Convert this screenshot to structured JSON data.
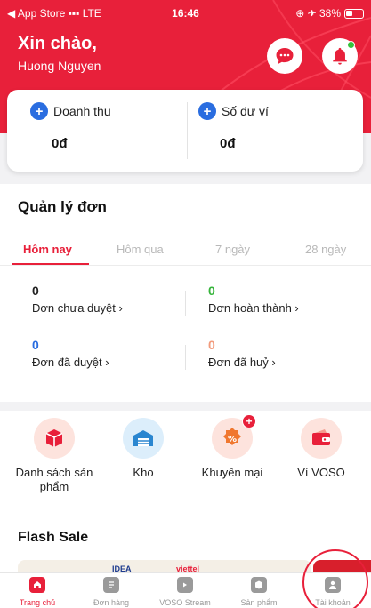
{
  "status_bar": {
    "left": "◀ App Store ▪▪▪ LTE",
    "time": "16:46",
    "right": "⊕ ✈ 38%"
  },
  "header": {
    "greeting": "Xin chào,",
    "username": "Huong Nguyen"
  },
  "stats": [
    {
      "label": "Doanh thu",
      "value": "0đ"
    },
    {
      "label": "Số dư ví",
      "value": "0đ"
    }
  ],
  "orders": {
    "title": "Quản lý đơn",
    "tabs": [
      "Hôm nay",
      "Hôm qua",
      "7 ngày",
      "28 ngày"
    ],
    "active_tab": "Hôm nay",
    "metrics": [
      {
        "value": "0",
        "label": "Đơn chưa duyệt  ›",
        "color": "#222222"
      },
      {
        "value": "0",
        "label": "Đơn hoàn thành  ›",
        "color": "#35b43a"
      },
      {
        "value": "0",
        "label": "Đơn đã duyệt  ›",
        "color": "#2a6de0"
      },
      {
        "value": "0",
        "label": "Đơn đã huỷ  ›",
        "color": "#f29b7c"
      }
    ]
  },
  "shortcuts": [
    {
      "label": "Danh sách sản phẩm",
      "icon": "box-icon"
    },
    {
      "label": "Kho",
      "icon": "warehouse-icon"
    },
    {
      "label": "Khuyến mại",
      "icon": "discount-icon",
      "badge": "+"
    },
    {
      "label": "Ví VOSO",
      "icon": "wallet-icon"
    }
  ],
  "flash_sale": {
    "title": "Flash Sale",
    "brands": [
      "IDEA",
      "viettel"
    ]
  },
  "bottom_nav": [
    {
      "label": "Trang chủ",
      "icon": "home-icon",
      "active": true
    },
    {
      "label": "Đơn hàng",
      "icon": "orders-icon"
    },
    {
      "label": "VOSO Stream",
      "icon": "video-icon"
    },
    {
      "label": "Sản phẩm",
      "icon": "product-icon"
    },
    {
      "label": "Tài khoản",
      "icon": "account-icon"
    }
  ],
  "colors": {
    "brand": "#e8203a",
    "blue": "#2a6de0",
    "green": "#35b43a",
    "peach": "#f29b7c"
  }
}
